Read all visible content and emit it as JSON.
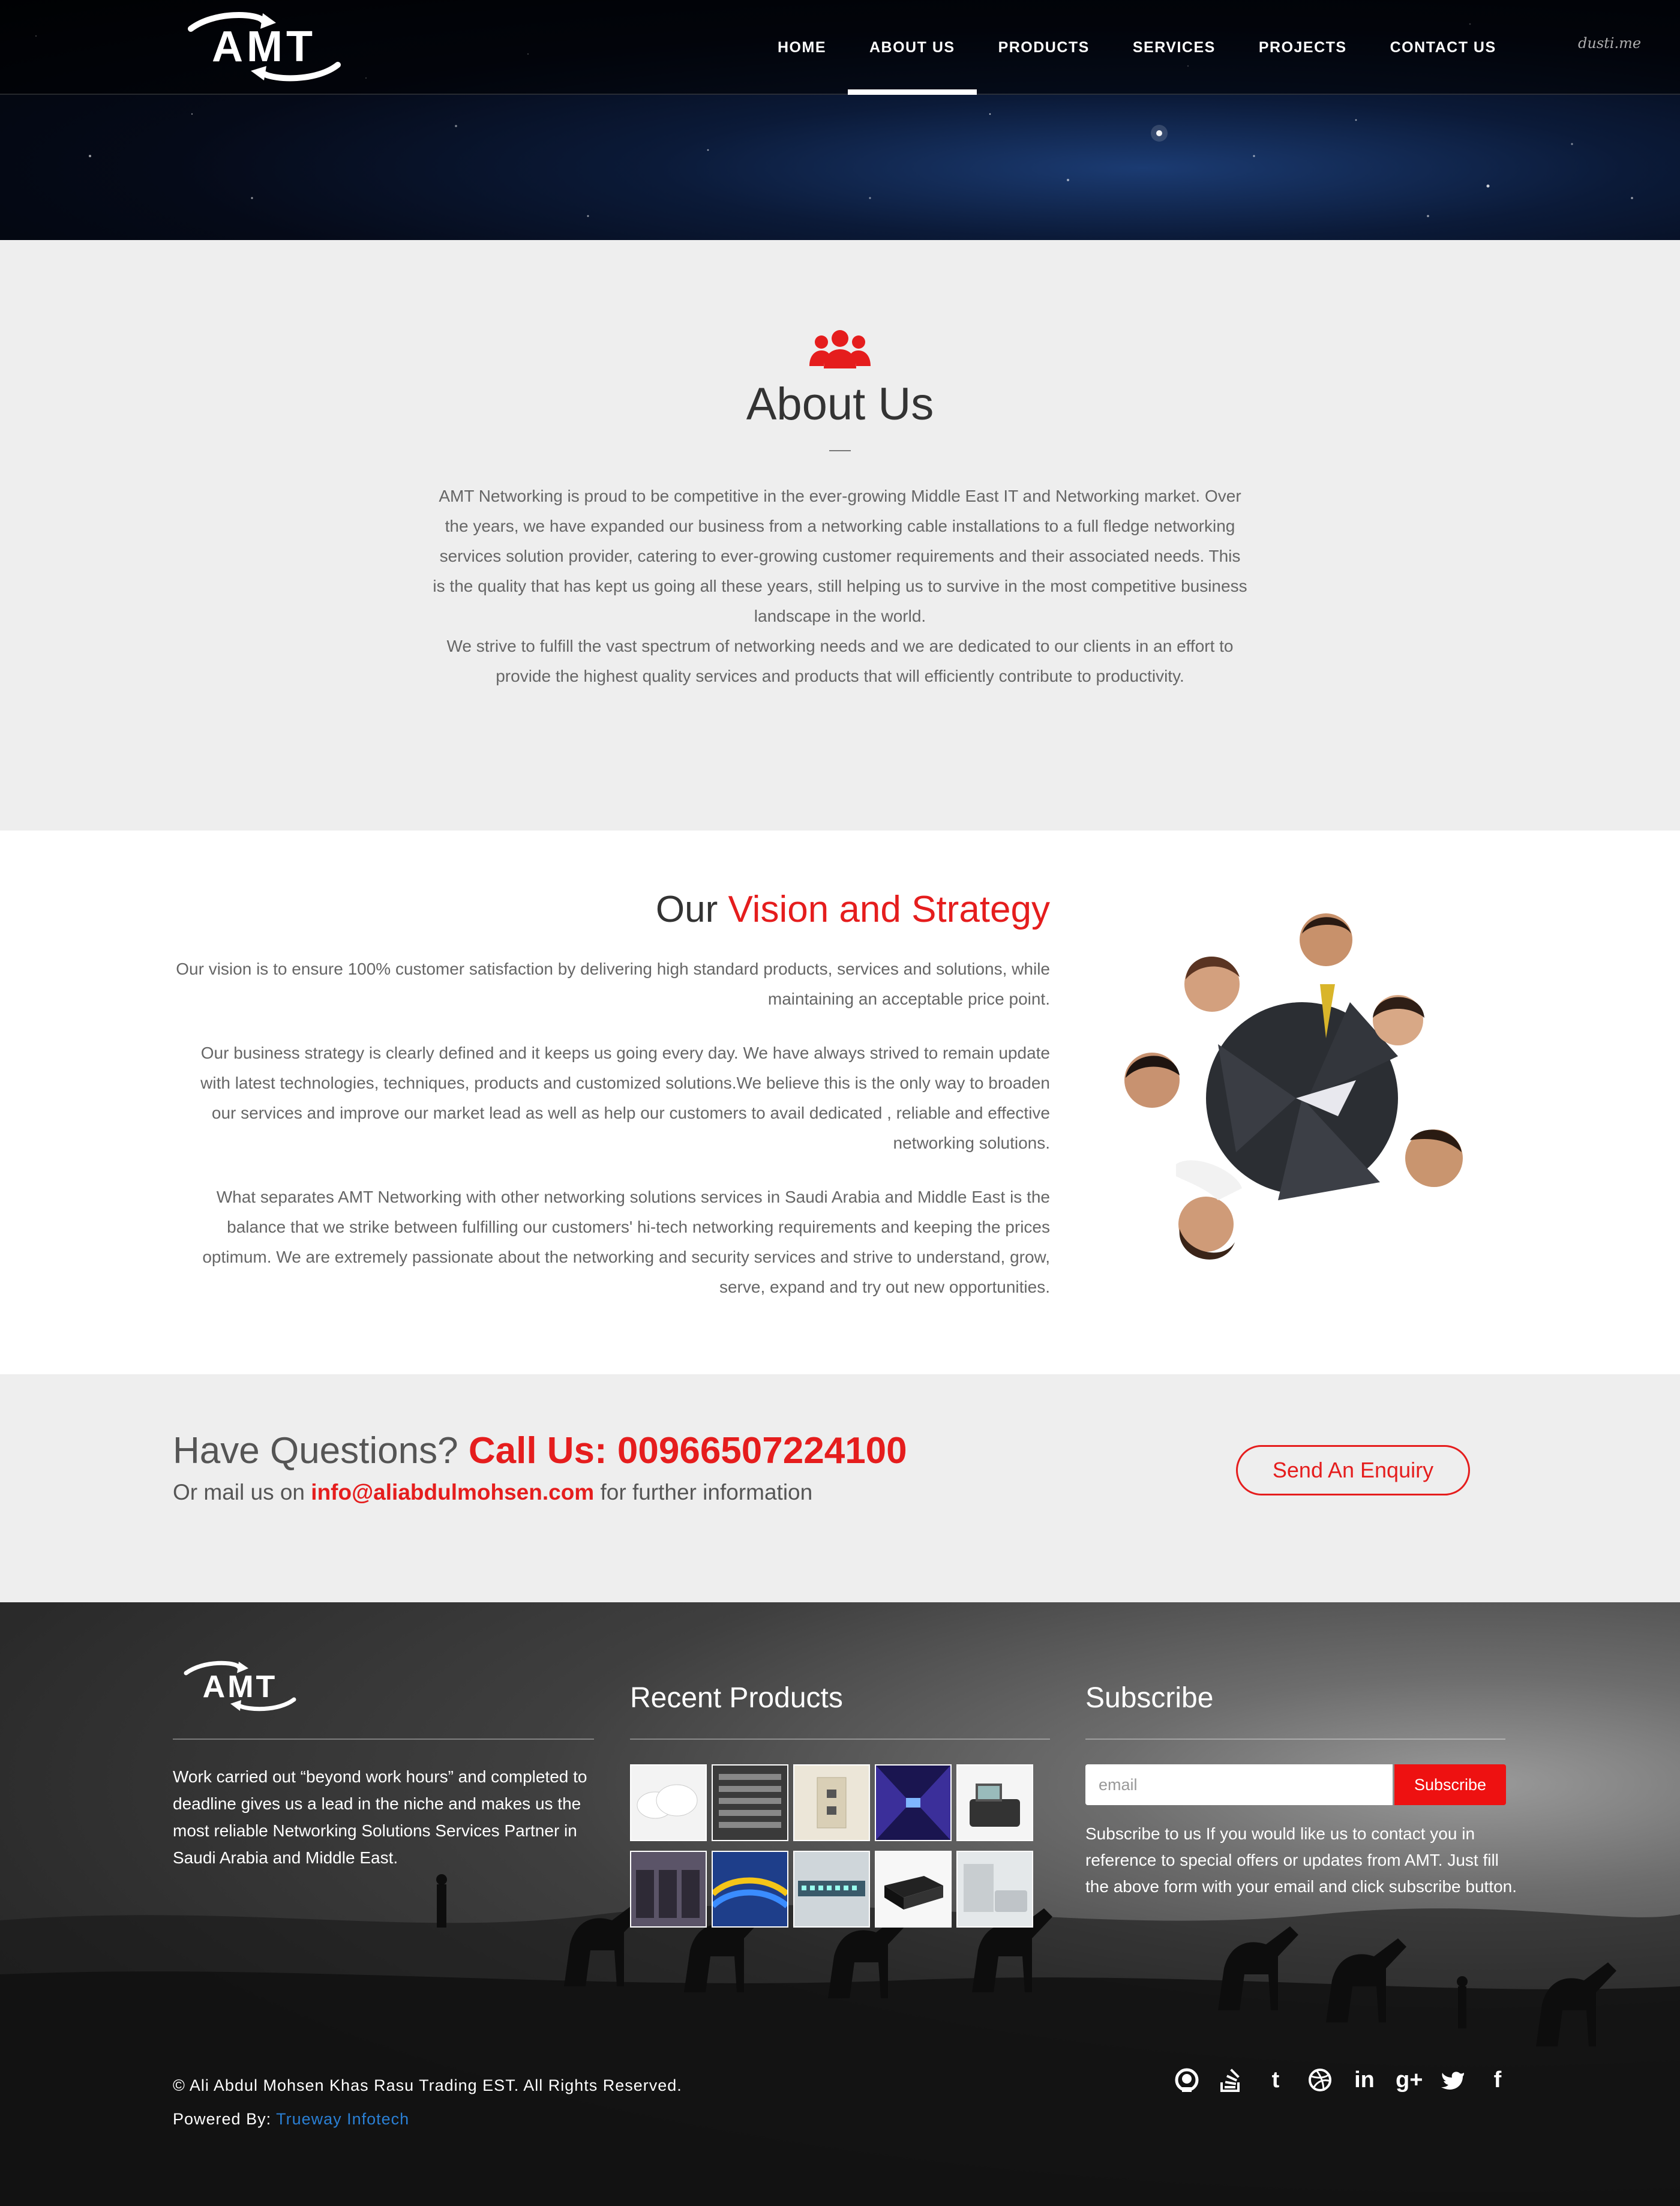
{
  "nav": {
    "logo_text": "AMT",
    "items": [
      {
        "label": "HOME",
        "active": false
      },
      {
        "label": "ABOUT US",
        "active": true
      },
      {
        "label": "PRODUCTS",
        "active": false
      },
      {
        "label": "SERVICES",
        "active": false
      },
      {
        "label": "PROJECTS",
        "active": false
      },
      {
        "label": "CONTACT US",
        "active": false
      }
    ],
    "signature": "dusti.me"
  },
  "about": {
    "icon": "team-icon",
    "title": "About Us",
    "paragraph1": "AMT Networking is proud to be competitive in the ever-growing Middle East IT and Networking market. Over the years, we have expanded our business from a networking cable installations to a full fledge networking services solution provider, catering to ever-growing customer requirements and their associated needs. This is the quality that has kept us going all these years, still helping us to survive in the most competitive business landscape in the world.",
    "paragraph2": "We strive to fulfill the vast spectrum of networking needs and we are dedicated to our clients in an effort to provide the highest quality services and products that will efficiently contribute to productivity."
  },
  "vision": {
    "title_plain": "Our",
    "title_highlight": "Vision and Strategy",
    "paragraphs": [
      "Our vision is to ensure 100% customer satisfaction by delivering high standard products, services and solutions, while maintaining an acceptable price point.",
      "Our business strategy is clearly defined and it keeps us going every day. We have always strived to remain update with latest technologies, techniques, products and customized solutions.We believe this is the only way to broaden our services and improve our market lead as well as help our customers to avail dedicated , reliable and effective networking solutions.",
      "What separates AMT Networking with other networking solutions services in Saudi Arabia and Middle East is the balance that we strike between fulfilling our customers' hi-tech networking requirements and keeping the prices optimum. We are extremely passionate about the networking and security services and strive to understand, grow, serve, expand and try out new opportunities."
    ]
  },
  "cta": {
    "question": "Have Questions?",
    "call_label": "Call Us: 00966507224100",
    "mail_prefix": "Or mail us on",
    "email": "info@aliabdulmohsen.com",
    "mail_suffix": "for further information",
    "button": "Send An Enquiry"
  },
  "footer": {
    "about_text": "Work carried out “beyond work hours” and completed to deadline gives us a lead in the niche and makes us the most reliable Networking Solutions Services Partner in Saudi Arabia and Middle East.",
    "products_title": "Recent Products",
    "subscribe_title": "Subscribe",
    "email_placeholder": "email",
    "subscribe_button": "Subscribe",
    "subscribe_text": "Subscribe to us If you would like us to contact you in reference to special offers or updates from AMT. Just fill the above form with your email and click subscribe button.",
    "copyright": "© Ali Abdul Mohsen Khas Rasu Trading EST. All Rights Reserved.",
    "powered_label": "Powered By:",
    "powered_link": "Trueway Infotech",
    "social": [
      "github-icon",
      "stackoverflow-icon",
      "tumblr-icon",
      "dribbble-icon",
      "linkedin-icon",
      "google-plus-icon",
      "twitter-icon",
      "facebook-icon"
    ]
  },
  "colors": {
    "accent": "#e51d1d",
    "footer_bg": "#2a2a2a",
    "section_bg": "#eeeeee",
    "link": "#2a7fd4"
  }
}
